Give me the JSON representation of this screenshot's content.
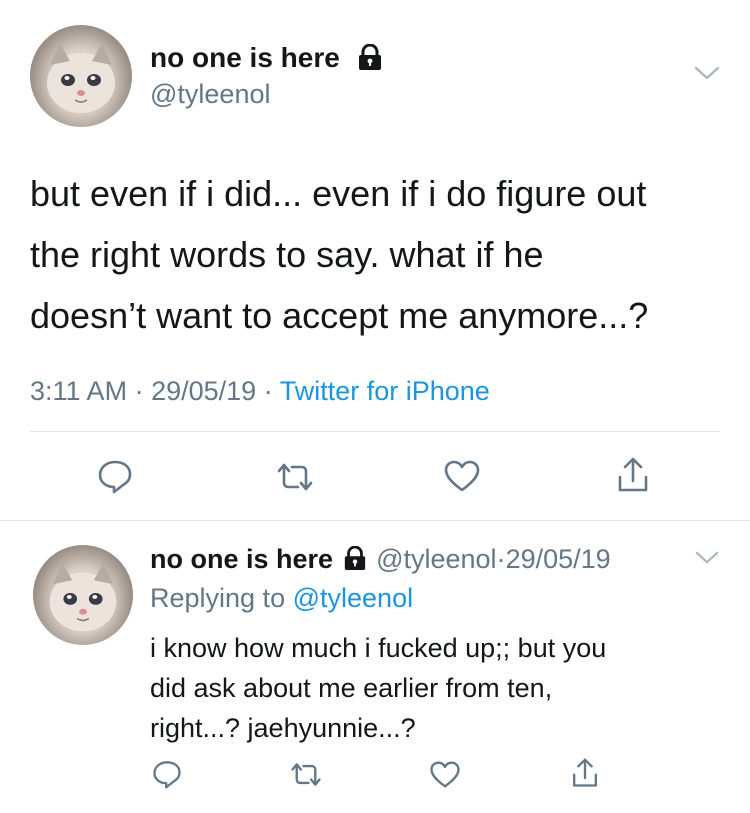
{
  "main_tweet": {
    "display_name": "no one is here",
    "handle": "@tyleenol",
    "text_lines": [
      "but even if i did... even if i do figure out",
      "the right words to say. what if he",
      "doesn’t want to accept me anymore...?"
    ],
    "time": "3:11 AM",
    "date": "29/05/19",
    "separator": "·",
    "source": "Twitter for iPhone",
    "icons": [
      "chevron-down-icon",
      "lock-icon",
      "reply-icon",
      "retweet-icon",
      "like-icon",
      "share-icon"
    ]
  },
  "reply_tweet": {
    "display_name": "no one is here",
    "handle": "@tyleenol",
    "separator": "·",
    "date": "29/05/19",
    "replying_prefix": "Replying to",
    "replying_to": "@tyleenol",
    "text_lines": [
      "i know how much i fucked up;; but you",
      "did ask about me earlier from ten,",
      "right...? jaehyunnie...?"
    ]
  },
  "colors": {
    "text": "#14171a",
    "muted": "#657786",
    "link": "#1b95e0",
    "icon": "#657786",
    "divider": "#e1e8ed"
  }
}
